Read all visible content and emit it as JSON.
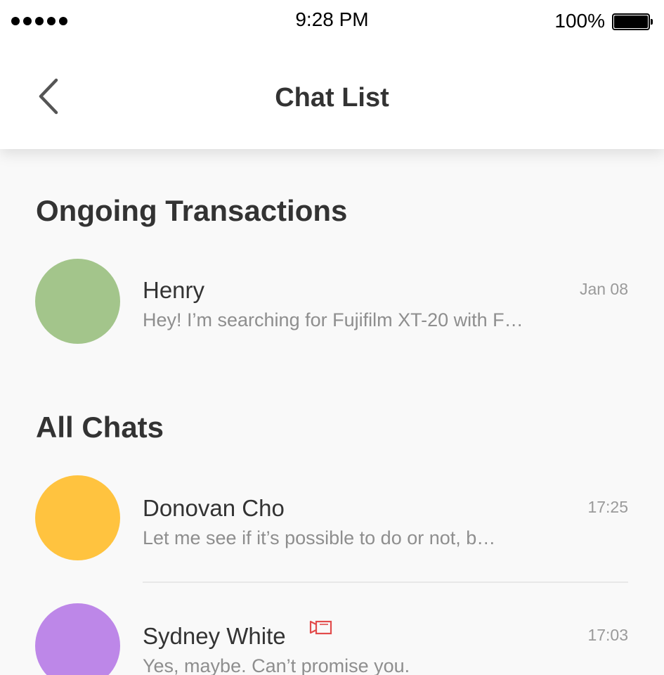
{
  "status_bar": {
    "time": "9:28 PM",
    "battery": "100%",
    "icons": [
      "signal-dots-icon",
      "battery-icon"
    ]
  },
  "nav": {
    "title": "Chat List",
    "back_icon": "chevron-left-icon"
  },
  "ongoing": {
    "title": "Ongoing Transactions",
    "chats": [
      {
        "name": "Henry",
        "message": "Hey! I’m searching for Fujifilm XT-20 with F…",
        "time": "Jan 08",
        "avatar_color": "#a3c58b"
      }
    ]
  },
  "all_chats": {
    "title": "All Chats",
    "chats": [
      {
        "name": "Donovan Cho",
        "message": "Let me see if it’s possible to do or not, b…",
        "time": "17:25",
        "avatar_color": "#ffc33f"
      },
      {
        "name": "Sydney White",
        "message": "Yes, maybe. Can’t promise you.",
        "time": "17:03",
        "avatar_color": "#bd87e8",
        "badge_icon": "video-camera-icon",
        "badge_color": "#e24c4c"
      }
    ]
  }
}
